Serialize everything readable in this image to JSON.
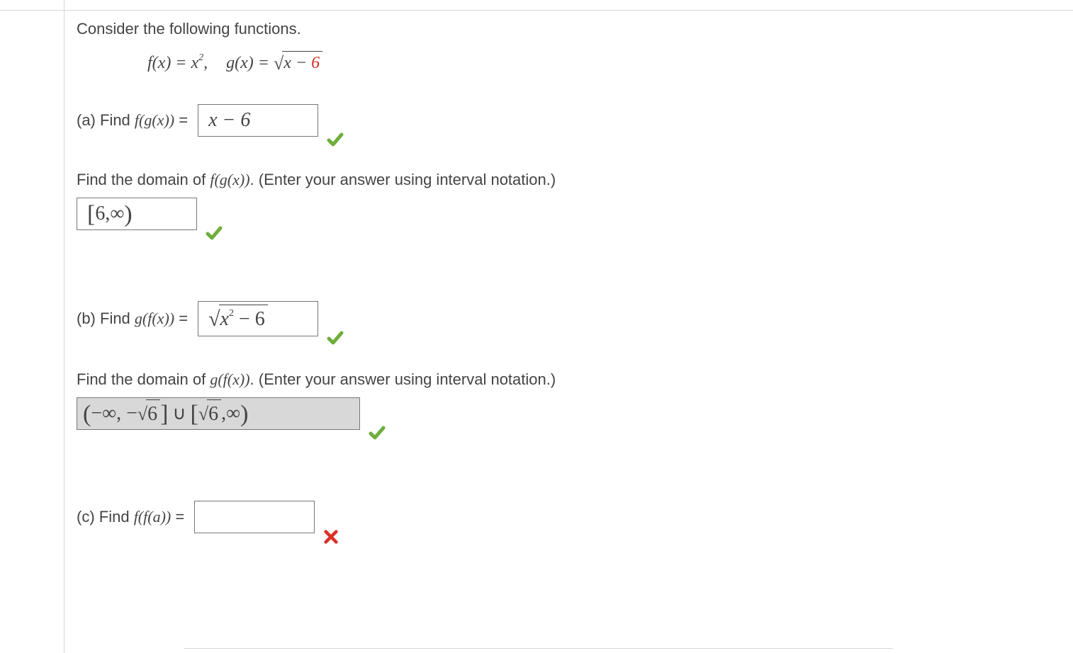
{
  "prompt": {
    "intro": "Consider the following functions.",
    "fx_lhs": "f(x) = x",
    "fx_exp": "2",
    "comma": ",",
    "gx_lhs": "g(x) = ",
    "gx_radicand_var": "x",
    "gx_radicand_op": " − ",
    "gx_radicand_const": "6"
  },
  "part_a": {
    "label_prefix": "(a) Find  ",
    "label_fn": "f(g(x))",
    "equals": "  =",
    "answer": "x − 6",
    "domain_prompt_1": "Find the domain of  ",
    "domain_prompt_fn": "f(g(x))",
    "domain_prompt_2": ".  (Enter your answer using interval notation.)",
    "domain_answer_open": "[",
    "domain_answer_a": "6,",
    "domain_answer_inf": "∞",
    "domain_answer_close": ")"
  },
  "part_b": {
    "label_prefix": "(b) Find  ",
    "label_fn": "g(f(x))",
    "equals": "  =",
    "answer_radicand_var": "x",
    "answer_radicand_exp": "2",
    "answer_radicand_rest": " − 6",
    "domain_prompt_1": "Find the domain of  ",
    "domain_prompt_fn": "g(f(x))",
    "domain_prompt_2": ".  (Enter your answer using interval notation.)",
    "domain_open1": "(",
    "domain_neg_inf": "−∞, − ",
    "domain_sqrt6_a": "6",
    "domain_close1": " ]",
    "domain_union": "∪",
    "domain_open2": "[ ",
    "domain_sqrt6_b": "6",
    "domain_rest": " ,∞",
    "domain_close2": ")"
  },
  "part_c": {
    "label_prefix": "(c) Find  ",
    "label_fn": "f(f(a))",
    "equals": "  =",
    "answer": ""
  },
  "status": {
    "correct": "correct",
    "incorrect": "incorrect"
  }
}
